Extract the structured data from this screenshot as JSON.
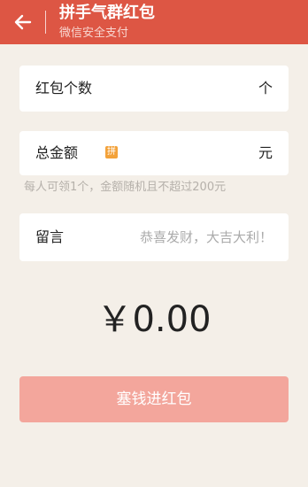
{
  "header": {
    "title": "拼手气群红包",
    "subtitle": "微信安全支付"
  },
  "count": {
    "label": "红包个数",
    "unit": "个"
  },
  "amount": {
    "label": "总金额",
    "badge": "拼",
    "unit": "元",
    "hint": "每人可领1个，金额随机且不超过200元"
  },
  "message": {
    "label": "留言",
    "placeholder": "恭喜发财，大吉大利！"
  },
  "total_display": "￥0.00",
  "submit_label": "塞钱进红包",
  "colors": {
    "header_bg": "#dd5644",
    "button_bg": "#f3a69c",
    "badge": "#f3a23a",
    "page_bg": "#f4efe8"
  }
}
